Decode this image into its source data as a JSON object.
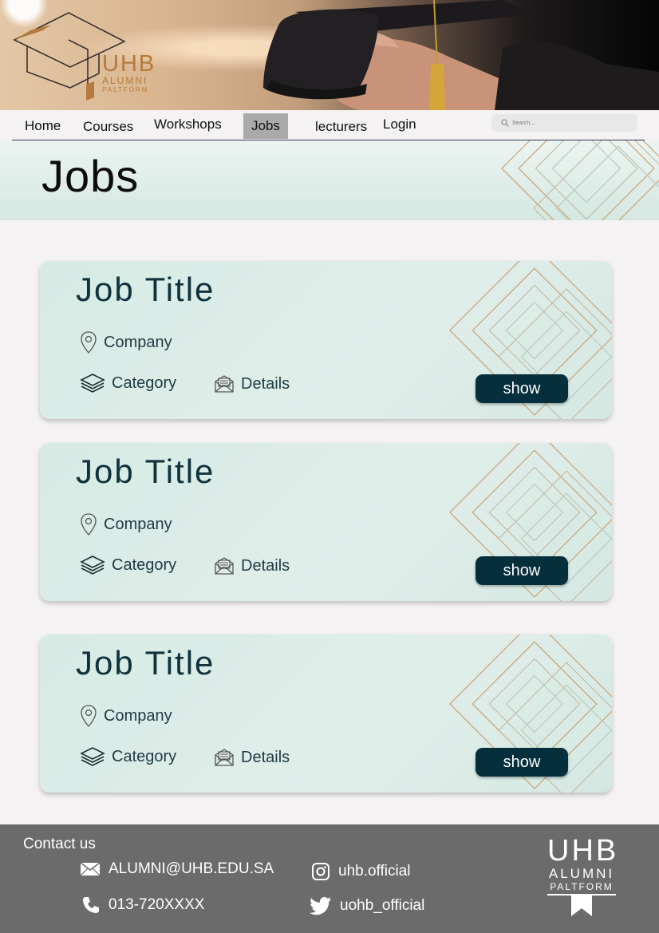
{
  "brand": {
    "logo_uhb": "UHB",
    "logo_alumni": "ALUMNI",
    "logo_paltform": "PALTFORM"
  },
  "nav": {
    "items": [
      {
        "label": "Home"
      },
      {
        "label": "Courses"
      },
      {
        "label": "Workshops"
      },
      {
        "label": "Jobs",
        "active": true
      },
      {
        "label": "lecturers"
      },
      {
        "label": "Login"
      }
    ],
    "search_placeholder": "Search..."
  },
  "page": {
    "title": "Jobs"
  },
  "jobs": [
    {
      "title": "Job Title",
      "company": "Company",
      "category": "Category",
      "details": "Details",
      "button": "show"
    },
    {
      "title": "Job Title",
      "company": "Company",
      "category": "Category",
      "details": "Details",
      "button": "show"
    },
    {
      "title": "Job Title",
      "company": "Company",
      "category": "Category",
      "details": "Details",
      "button": "show"
    }
  ],
  "footer": {
    "contact_label": "Contact us",
    "email": "ALUMNI@UHB.EDU.SA",
    "phone": "013-720XXXX",
    "instagram": "uhb.official",
    "twitter": "uohb_official",
    "logo_uhb": "UHB",
    "logo_alumni": "ALUMNI",
    "logo_paltform": "PALTFORM"
  },
  "icons": {
    "company": "location-pin-icon",
    "category": "layers-icon",
    "details": "envelope-open-icon",
    "email": "mail-icon",
    "phone": "phone-icon",
    "instagram": "instagram-icon",
    "twitter": "twitter-icon",
    "search": "search-icon"
  },
  "colors": {
    "primary_dark": "#062f3d",
    "card_bg": "#d6ebe5",
    "footer_bg": "#6b6b6b",
    "accent_gold": "#b47a3c",
    "nav_active": "#aaaaaa"
  }
}
